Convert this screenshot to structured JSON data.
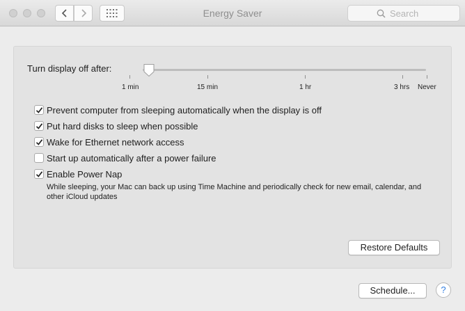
{
  "window": {
    "title": "Energy Saver"
  },
  "search": {
    "placeholder": "Search"
  },
  "slider": {
    "label": "Turn display off after:",
    "value": "2 min",
    "ticks": [
      "1 min",
      "15 min",
      "1 hr",
      "3 hrs",
      "Never"
    ]
  },
  "options": [
    {
      "label": "Prevent computer from sleeping automatically when the display is off",
      "checked": true
    },
    {
      "label": "Put hard disks to sleep when possible",
      "checked": true
    },
    {
      "label": "Wake for Ethernet network access",
      "checked": true
    },
    {
      "label": "Start up automatically after a power failure",
      "checked": false
    },
    {
      "label": "Enable Power Nap",
      "checked": true
    }
  ],
  "power_nap_description": "While sleeping, your Mac can back up using Time Machine and periodically check for new email, calendar, and other iCloud updates",
  "buttons": {
    "restore_defaults": "Restore Defaults",
    "schedule": "Schedule...",
    "help": "?"
  },
  "colors": {
    "accent": "#2f7de1",
    "background": "#ececec",
    "panel": "#e3e3e3"
  }
}
